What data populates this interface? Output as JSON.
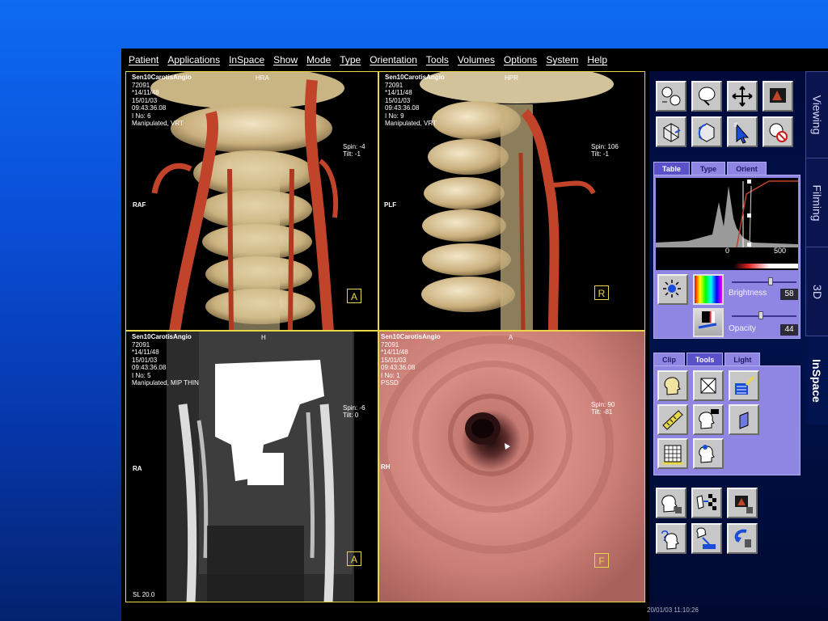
{
  "menu": [
    "Patient",
    "Applications",
    "InSpace",
    "Show",
    "Mode",
    "Type",
    "Orientation",
    "Tools",
    "Volumes",
    "Options",
    "System",
    "Help"
  ],
  "viewports": {
    "tl": {
      "patient": "Sen10CarotisAngio",
      "id": "72091",
      "dob": "*14/11/48",
      "date": "15/01/03",
      "time": "09:43:36.08",
      "image_no": "I No: 6",
      "processing": "Manipulated, VRT",
      "orientation_top": "HRA",
      "orientation_left": "RAF",
      "spin": "Spin: -4",
      "tilt": "Tilt: -1",
      "marker": "A"
    },
    "tr": {
      "patient": "Sen10CarotisAngio",
      "id": "72091",
      "dob": "*14/11/48",
      "date": "15/01/03",
      "time": "09:43:36.08",
      "image_no": "I No: 9",
      "processing": "Manipulated, VRT",
      "orientation_top": "HPR",
      "orientation_left": "PLF",
      "spin": "Spin: 106",
      "tilt": "Tilt: -1",
      "marker": "R"
    },
    "bl": {
      "patient": "Sen10CarotisAngio",
      "id": "72091",
      "dob": "*14/11/48",
      "date": "15/01/03",
      "time": "09:43:36.08",
      "image_no": "I No: 5",
      "processing": "Manipulated, MIP THIN",
      "orientation_top": "H",
      "orientation_left": "RA",
      "spin": "Spin: -6",
      "tilt": "Tilt: 0",
      "marker": "A",
      "slice": "SL 20.0"
    },
    "br": {
      "patient": "Sen10CarotisAngio",
      "id": "72091",
      "dob": "*14/11/48",
      "date": "15/01/03",
      "time": "09:43:36.08",
      "image_no": "I No: 1",
      "processing": "PSSD",
      "orientation_top": "A",
      "orientation_left": "RH",
      "spin": "Spin: 90",
      "tilt": "Tilt: -81",
      "marker": "F"
    }
  },
  "side_tabs": [
    "Viewing",
    "Filming",
    "3D",
    "InSpace"
  ],
  "table_panel": {
    "tabs": [
      "Table",
      "Type",
      "Orient"
    ],
    "axis_labels": [
      "0",
      "500"
    ],
    "brightness_label": "Brightness",
    "brightness_value": "58",
    "brightness_level": 0.6,
    "opacity_label": "Opacity",
    "opacity_value": "44",
    "opacity_level": 0.45
  },
  "tools_panel": {
    "tabs": [
      "Clip",
      "Tools",
      "Light"
    ]
  },
  "top_tools": [
    "rotate-icon",
    "zoom-3d-icon",
    "pan-icon",
    "red-display-icon",
    "volume-cube-icon",
    "rotate-volume-icon",
    "pointer-icon",
    "no-edit-icon"
  ],
  "bottom_tools": [
    "head-view-icon",
    "export-series-icon",
    "film-icon",
    "help-icon",
    "save-view-icon",
    "undo-icon"
  ],
  "timestamp": "20/01/03 11:10:26",
  "colors": {
    "accent": "#e8d64a",
    "panel": "#8f86e4",
    "tab_active": "#5a51c9"
  }
}
